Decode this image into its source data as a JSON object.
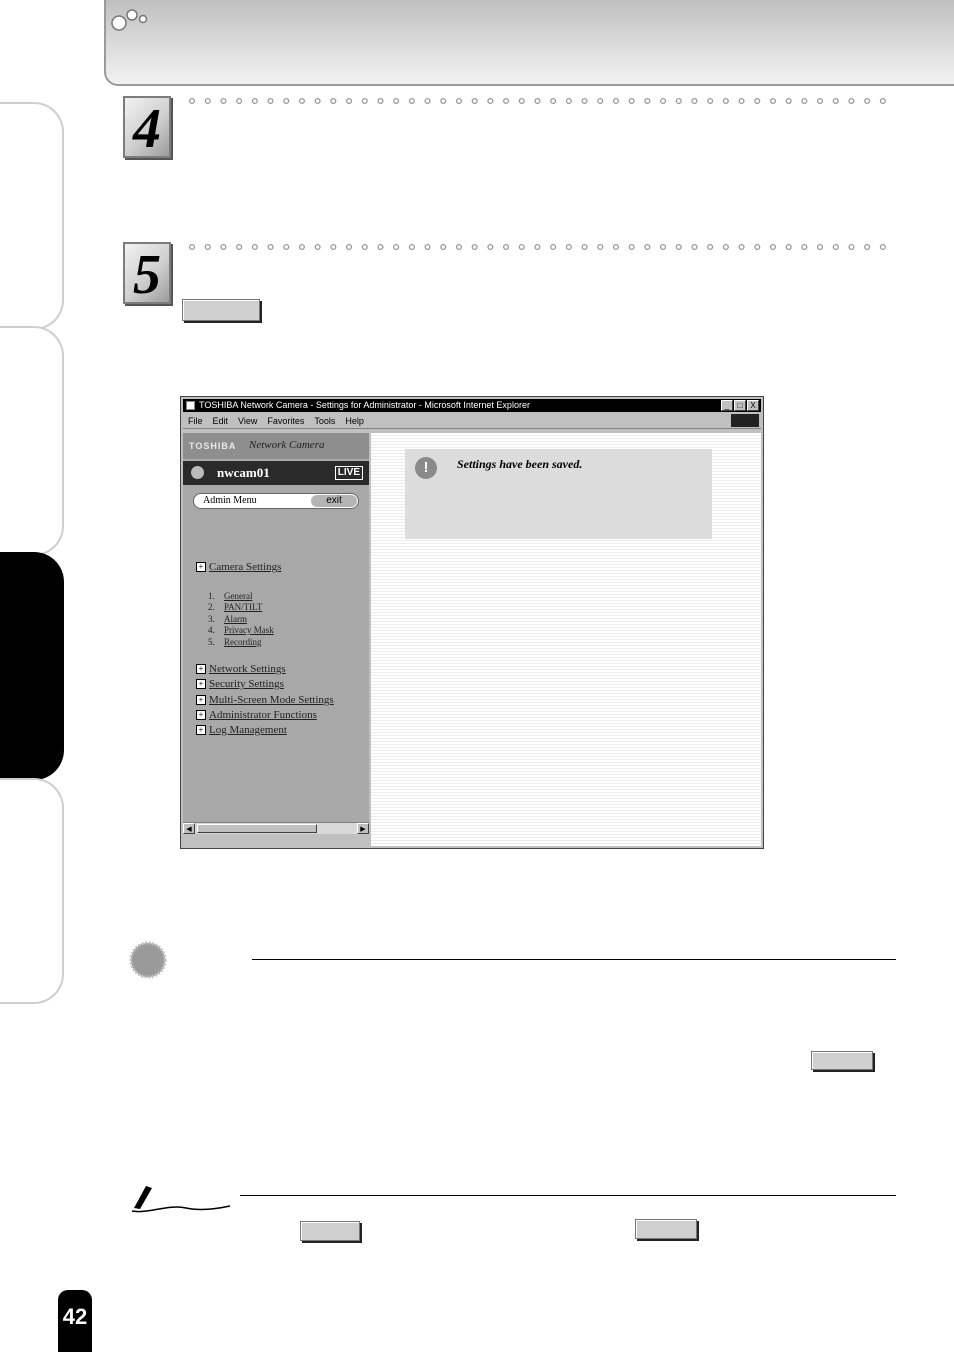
{
  "steps": [
    {
      "number": "4"
    },
    {
      "number": "5"
    }
  ],
  "browser": {
    "title": "TOSHIBA Network Camera - Settings for Administrator - Microsoft Internet Explorer",
    "window_controls": [
      "_",
      "□",
      "X"
    ],
    "menu": [
      "File",
      "Edit",
      "View",
      "Favorites",
      "Tools",
      "Help"
    ],
    "brand": "TOSHIBA",
    "product": "Network Camera",
    "camera_name": "nwcam01",
    "live_label": "LIVE",
    "admin_menu_label": "Admin Menu",
    "exit_label": "exit",
    "camera_settings": "Camera Settings",
    "camera_sub": [
      {
        "n": "1.",
        "label": "General"
      },
      {
        "n": "2.",
        "label": "PAN/TILT"
      },
      {
        "n": "3.",
        "label": "Alarm"
      },
      {
        "n": "4.",
        "label": "Privacy Mask"
      },
      {
        "n": "5.",
        "label": "Recording"
      }
    ],
    "sections": [
      "Network Settings",
      "Security Settings",
      "Multi-Screen Mode Settings",
      "Administrator Functions",
      "Log Management"
    ],
    "message": "Settings have been saved.",
    "scroll_left": "◀",
    "scroll_right": "▶"
  },
  "page_number": "42",
  "colors": {
    "active_tab": "#000000",
    "header_gray": "#cfcfcf"
  }
}
